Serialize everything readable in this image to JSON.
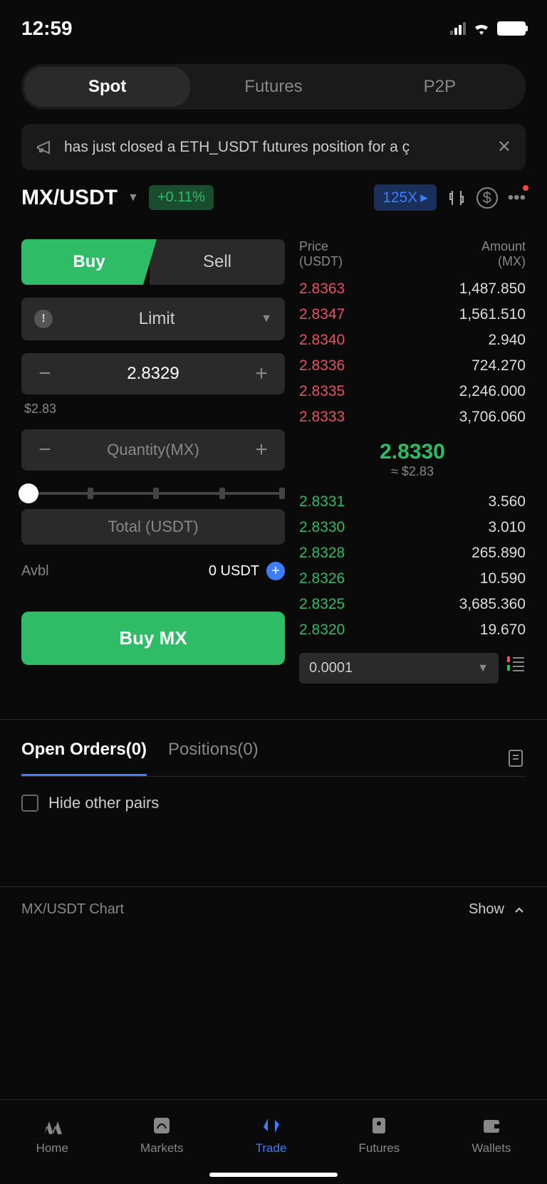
{
  "status": {
    "time": "12:59"
  },
  "tabs": {
    "spot": "Spot",
    "futures": "Futures",
    "p2p": "P2P"
  },
  "announcement": {
    "text": "has just closed a ETH_USDT futures position for a ç"
  },
  "pair": {
    "name": "MX/USDT",
    "change": "+0.11%",
    "leverage": "125X"
  },
  "trade": {
    "buy": "Buy",
    "sell": "Sell",
    "order_type": "Limit",
    "price": "2.8329",
    "price_usd": "$2.83",
    "qty_placeholder": "Quantity(MX)",
    "total_placeholder": "Total (USDT)",
    "avbl_label": "Avbl",
    "avbl_value": "0 USDT",
    "buy_btn": "Buy  MX"
  },
  "orderbook": {
    "price_header": "Price",
    "price_unit": "(USDT)",
    "amount_header": "Amount",
    "amount_unit": "(MX)",
    "asks": [
      {
        "price": "2.8363",
        "amount": "1,487.850"
      },
      {
        "price": "2.8347",
        "amount": "1,561.510"
      },
      {
        "price": "2.8340",
        "amount": "2.940"
      },
      {
        "price": "2.8336",
        "amount": "724.270"
      },
      {
        "price": "2.8335",
        "amount": "2,246.000"
      },
      {
        "price": "2.8333",
        "amount": "3,706.060"
      }
    ],
    "current": {
      "price": "2.8330",
      "usd": "≈ $2.83"
    },
    "bids": [
      {
        "price": "2.8331",
        "amount": "3.560"
      },
      {
        "price": "2.8330",
        "amount": "3.010"
      },
      {
        "price": "2.8328",
        "amount": "265.890"
      },
      {
        "price": "2.8326",
        "amount": "10.590"
      },
      {
        "price": "2.8325",
        "amount": "3,685.360"
      },
      {
        "price": "2.8320",
        "amount": "19.670"
      }
    ],
    "precision": "0.0001"
  },
  "orders": {
    "open": "Open Orders(0)",
    "positions": "Positions(0)",
    "hide": "Hide other pairs"
  },
  "chart": {
    "label": "MX/USDT Chart",
    "show": "Show"
  },
  "nav": {
    "home": "Home",
    "markets": "Markets",
    "trade": "Trade",
    "futures": "Futures",
    "wallets": "Wallets"
  }
}
